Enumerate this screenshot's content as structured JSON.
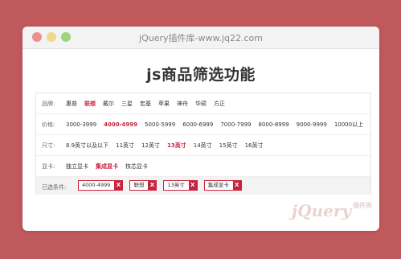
{
  "window": {
    "title": "jQuery插件库-www.jq22.com"
  },
  "page_title": "js商品筛选功能",
  "filters": [
    {
      "label": "品牌:",
      "options": [
        "惠普",
        "联想",
        "戴尔",
        "三星",
        "宏基",
        "苹果",
        "神舟",
        "华硕",
        "方正"
      ],
      "selected": "联想"
    },
    {
      "label": "价格:",
      "options": [
        "3000-3999",
        "4000-4999",
        "5000-5999",
        "6000-6999",
        "7000-7999",
        "8000-8999",
        "9000-9999",
        "10000以上"
      ],
      "selected": "4000-4999"
    },
    {
      "label": "尺寸:",
      "options": [
        "8.9英寸以及以下",
        "11英寸",
        "12英寸",
        "13英寸",
        "14英寸",
        "15英寸",
        "16英寸"
      ],
      "selected": "13英寸"
    },
    {
      "label": "显卡:",
      "options": [
        "独立显卡",
        "集成显卡",
        "核芯显卡"
      ],
      "selected": "集成显卡"
    }
  ],
  "selected_bar": {
    "label": "已选条件:",
    "tags": [
      "4000-4999",
      "联想",
      "13英寸",
      "集成显卡"
    ],
    "remove_glyph": "X"
  },
  "watermark": {
    "text": "jQuery",
    "sub": "插件库"
  },
  "colors": {
    "background": "#c0595b",
    "accent": "#c8243f"
  }
}
